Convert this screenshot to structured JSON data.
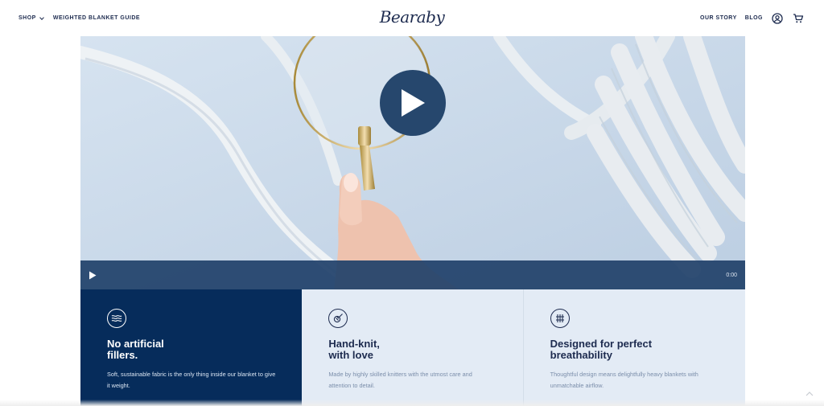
{
  "header": {
    "nav_left": [
      {
        "label": "SHOP",
        "has_dropdown": true
      },
      {
        "label": "WEIGHTED BLANKET GUIDE"
      }
    ],
    "logo": "Bearaby",
    "nav_right": [
      {
        "label": "OUR STORY"
      },
      {
        "label": "BLOG"
      }
    ],
    "icons": [
      "account-icon",
      "cart-icon"
    ]
  },
  "video": {
    "time": "0:00"
  },
  "features": [
    {
      "icon": "waves-icon",
      "title": "No artificial\nfillers.",
      "description": "Soft, sustainable fabric is the only thing inside our blanket to give it weight."
    },
    {
      "icon": "knit-needle-icon",
      "title": "Hand-knit,\nwith love",
      "description": "Made by highly skilled knitters with the utmost care and attention to detail."
    },
    {
      "icon": "grid-breathable-icon",
      "title": "Designed for perfect\nbreathability",
      "description": "Thoughtful design means delightfully heavy blankets with unmatchable airflow."
    }
  ],
  "colors": {
    "brand_navy": "#062c5b",
    "text_navy": "#1d2b4f",
    "light_panel": "#e3ebf5",
    "video_control_bar": "#21426b"
  }
}
